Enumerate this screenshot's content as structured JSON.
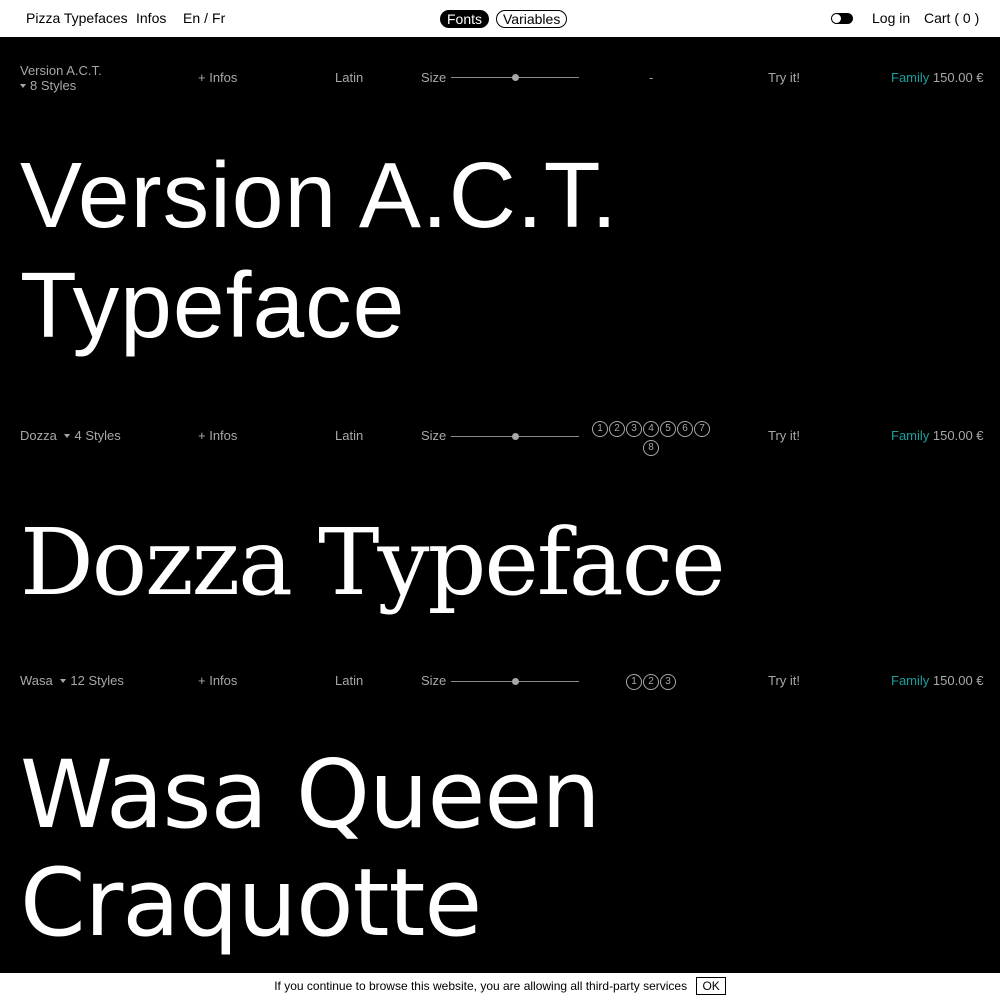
{
  "header": {
    "brand": "Pizza Typefaces",
    "infos": "Infos",
    "lang_en": "En",
    "lang_sep": "/",
    "lang_fr": "Fr",
    "tab_fonts": "Fonts",
    "tab_variables": "Variables",
    "login": "Log in",
    "cart": "Cart ( 0 )"
  },
  "rows": [
    {
      "name": "Version A.C.T.",
      "styles": "8 Styles",
      "infos": "+ Infos",
      "script": "Latin",
      "size_label": "Size",
      "size_level": 0.5,
      "style_selector": "-",
      "try": "Try it!",
      "family": "Family",
      "price": "150.00 €",
      "specimen_line1": "Version A.C.T.",
      "specimen_line2": "Typeface"
    },
    {
      "name": "Dozza",
      "styles": "4 Styles",
      "infos": "+ Infos",
      "script": "Latin",
      "size_label": "Size",
      "size_level": 0.5,
      "style_numbers": [
        "1",
        "2",
        "3",
        "4",
        "5",
        "6",
        "7",
        "8"
      ],
      "try": "Try it!",
      "family": "Family",
      "price": "150.00 €",
      "specimen_line1": "Dozza Typeface"
    },
    {
      "name": "Wasa",
      "styles": "12 Styles",
      "infos": "+ Infos",
      "script": "Latin",
      "size_label": "Size",
      "size_level": 0.5,
      "style_numbers": [
        "1",
        "2",
        "3"
      ],
      "try": "Try it!",
      "family": "Family",
      "price": "150.00 €",
      "specimen_line1": "Wasa Queen",
      "specimen_line2": "Craquotte"
    }
  ],
  "cookie": {
    "message": "If you continue to browse this website, you are allowing all third-party services",
    "ok": "OK"
  },
  "colors": {
    "background": "#000000",
    "header_bg": "#ffffff",
    "meta_text": "#a8a8a8",
    "family_accent": "#1a9e9a"
  }
}
